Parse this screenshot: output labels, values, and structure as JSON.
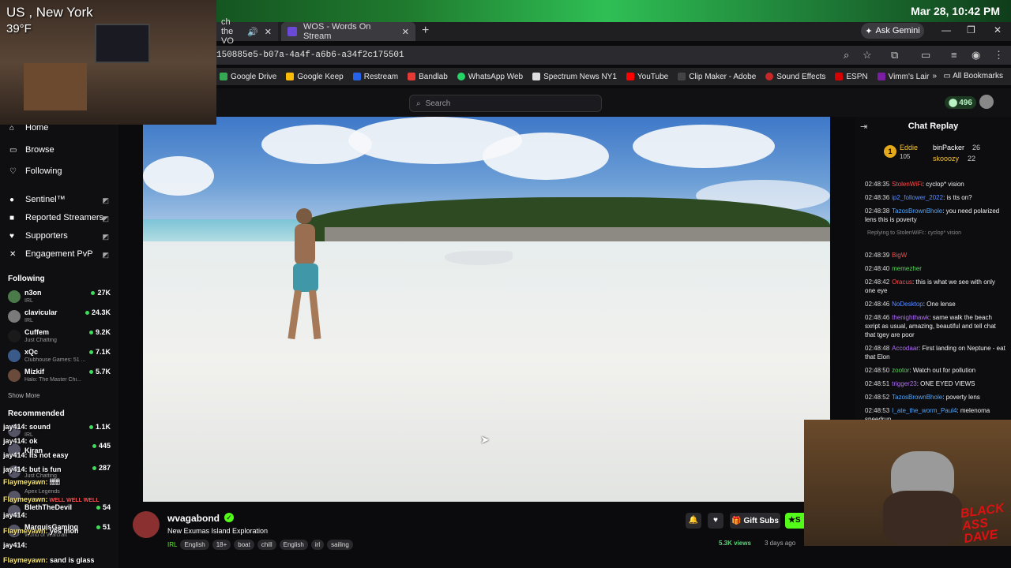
{
  "desktop": {
    "clock": "Mar 28, 10:42 PM"
  },
  "overlay": {
    "location": "US , New York",
    "temp": "39°F",
    "watermark": "BLACK ASS DAVE"
  },
  "browser": {
    "tabs": [
      {
        "label": "ch the VO"
      },
      {
        "label": "WOS - Words On Stream"
      }
    ],
    "new_tab": "+",
    "ask_gemini": "Ask Gemini",
    "url": "150885e5-b07a-4a4f-a6b6-a34f2c175501",
    "bookmarks": [
      "Google Drive",
      "Google Keep",
      "Restream",
      "Bandlab",
      "WhatsApp Web",
      "Spectrum News NY1",
      "YouTube",
      "Clip Maker - Adobe",
      "Sound Effects",
      "ESPN",
      "Vimm's Lair"
    ],
    "all_bookmarks": "All Bookmarks"
  },
  "header": {
    "search_placeholder": "Search",
    "coins": "496"
  },
  "sidebar": {
    "nav": [
      {
        "label": "Home"
      },
      {
        "label": "Browse"
      },
      {
        "label": "Following"
      }
    ],
    "tools": [
      {
        "label": "Sentinel™"
      },
      {
        "label": "Reported Streamers"
      },
      {
        "label": "Supporters"
      },
      {
        "label": "Engagement PvP"
      }
    ],
    "following_title": "Following",
    "following": [
      {
        "name": "n3on",
        "category": "IRL",
        "viewers": "27K"
      },
      {
        "name": "clavicular",
        "category": "IRL",
        "viewers": "24.3K"
      },
      {
        "name": "Cuffem",
        "category": "Just Chatting",
        "viewers": "9.2K"
      },
      {
        "name": "xQc",
        "category": "Clubhouse Games: 51 ...",
        "viewers": "7.1K"
      },
      {
        "name": "Mizkif",
        "category": "Halo: The Master Chi...",
        "viewers": "5.7K"
      }
    ],
    "show_more": "Show More",
    "recommended_title": "Recommended",
    "recommended_viewers": [
      "1.1K",
      "445",
      "287",
      "54",
      "51"
    ],
    "recommended_names": [
      "Kiran",
      "BlethTheDevil",
      "MarquisGaming"
    ],
    "recommended_categories": [
      "IRL",
      "Just Chatting",
      "Apex Legends",
      "World of Warcraft"
    ]
  },
  "obs_chat": [
    {
      "user": "jay414:",
      "text": " sound"
    },
    {
      "user": "jay414:",
      "text": " ok"
    },
    {
      "user": "jay414:",
      "text": " Its not easy"
    },
    {
      "user": "jay414:",
      "text": " but is fun"
    },
    {
      "user": "Flaymeyawn:",
      "text": " 🕯🕯🕯🕯🕯"
    },
    {
      "user": "Flaymeyawn:",
      "text": " WELL WELL WELL"
    },
    {
      "user": "jay414:",
      "text": ""
    },
    {
      "user": "Flaymeyawn:",
      "text": " yes mon"
    },
    {
      "user": "jay414:",
      "text": ""
    },
    {
      "user": "Flaymeyawn:",
      "text": " sand is glass"
    }
  ],
  "chat": {
    "title": "Chat Replay",
    "podium": [
      {
        "rank": "1",
        "name": "Eddie",
        "count": "105"
      },
      {
        "name": "binPacker",
        "count": "26"
      },
      {
        "name": "skooozy",
        "count": "22"
      }
    ],
    "messages": [
      {
        "time": "02:48:35",
        "user": "StolenWiFi",
        "color": "#ff4d4d",
        "text": "cyclop* vision"
      },
      {
        "time": "02:48:36",
        "user": "ip2_follower_2022",
        "color": "#5b8cff",
        "text": "is tts on?"
      },
      {
        "time": "02:48:38",
        "user": "TazosBrownBhole",
        "color": "#4da6ff",
        "text": "you need polarized lens this is poverty"
      },
      {
        "time": "",
        "user": "Replying to StolenWiFi:",
        "color": "#888888",
        "text": "cyclop* vision"
      },
      {
        "time": "02:48:39",
        "user": "BigW",
        "color": "#ff4d4d",
        "text": ""
      },
      {
        "time": "02:48:40",
        "user": "memezher",
        "color": "#5cd65c",
        "text": ""
      },
      {
        "time": "02:48:42",
        "user": "Oracus",
        "color": "#ff4d4d",
        "text": "this is what we see with only one eye"
      },
      {
        "time": "02:48:46",
        "user": "NoDesktop",
        "color": "#5b8cff",
        "text": "One lense"
      },
      {
        "time": "02:48:46",
        "user": "thenighthawk",
        "color": "#b36bff",
        "text": "same walk the beach sxript as usual, amazing, beautiful and tell chat that tgey are poor"
      },
      {
        "time": "02:48:48",
        "user": "Accodaar",
        "color": "#b36bff",
        "text": "First landing on Neptune - eat that Elon"
      },
      {
        "time": "02:48:50",
        "user": "zootor",
        "color": "#5cd65c",
        "text": "Watch out for pollution"
      },
      {
        "time": "02:48:51",
        "user": "trigger23",
        "color": "#b36bff",
        "text": "ONE EYED VIEWS"
      },
      {
        "time": "02:48:52",
        "user": "TazosBrownBhole",
        "color": "#4da6ff",
        "text": "poverty lens"
      },
      {
        "time": "02:48:53",
        "user": "I_ate_the_worm_Paul4",
        "color": "#4da6ff",
        "text": "melenoma speedrun"
      }
    ]
  },
  "stream": {
    "channel": "wvagabond",
    "title": "New Exumas Island Exploration",
    "category": "IRL",
    "tags": [
      "English",
      "18+",
      "boat",
      "chill",
      "English",
      "irl",
      "sailing"
    ],
    "gift_subs": "Gift Subs",
    "subscribe": "S",
    "views": "5.3K views",
    "ago": "3 days ago"
  }
}
